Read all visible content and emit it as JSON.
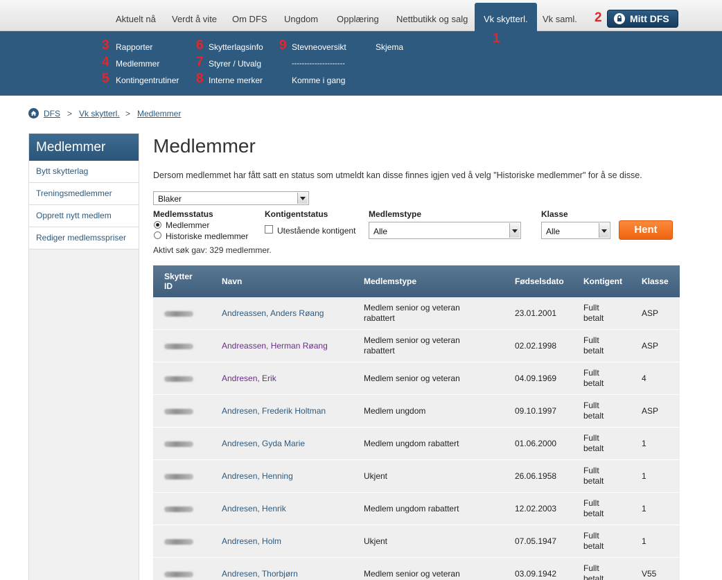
{
  "topnav": {
    "tabs": [
      {
        "label": "Aktuelt nå"
      },
      {
        "label": "Verdt å vite"
      },
      {
        "label": "Om DFS"
      },
      {
        "label": "Ungdom"
      },
      {
        "label": "Opplæring"
      },
      {
        "label": "Nettbutikk og salg"
      },
      {
        "label": "Vk skytterl."
      },
      {
        "label": "Vk saml."
      }
    ],
    "mitt_dfs": "Mitt DFS",
    "annotations": [
      "1",
      "2"
    ]
  },
  "submenu": {
    "items": [
      {
        "label": "Rapporter",
        "num": "3"
      },
      {
        "label": "Medlemmer",
        "num": "4"
      },
      {
        "label": "Kontingentrutiner",
        "num": "5"
      },
      {
        "label": "Skytterlagsinfo",
        "num": "6"
      },
      {
        "label": "Styrer / Utvalg",
        "num": "7"
      },
      {
        "label": "Interne merker",
        "num": "8"
      },
      {
        "label": "Stevneoversikt",
        "num": "9"
      },
      {
        "label": "Komme i gang"
      },
      {
        "label": "Skjema"
      }
    ],
    "separator": "---------------------"
  },
  "breadcrumb": {
    "items": [
      "DFS",
      "Vk skytterl.",
      "Medlemmer"
    ],
    "sep": ">"
  },
  "sidebar": {
    "title": "Medlemmer",
    "links": [
      "Bytt skytterlag",
      "Treningsmedlemmer",
      "Opprett nytt medlem",
      "Rediger medlemsspriser"
    ]
  },
  "main": {
    "title": "Medlemmer",
    "intro": "Dersom medlemmet har fått satt en status som utmeldt kan disse finnes igjen ved å velg \"Historiske medlemmer\" for å se disse.",
    "club_select": "Blaker",
    "filters": {
      "status_label": "Medlemsstatus",
      "status_options": [
        "Medlemmer",
        "Historiske medlemmer"
      ],
      "kontigent_label": "Kontigentstatus",
      "kontigent_option": "Utestående kontigent",
      "type_label": "Medlemstype",
      "type_value": "Alle",
      "klasse_label": "Klasse",
      "klasse_value": "Alle",
      "button": "Hent"
    },
    "result": "Aktivt søk gav: 329 medlemmer."
  },
  "table": {
    "headers": [
      "Skytter ID",
      "Navn",
      "Medlemstype",
      "Fødselsdato",
      "Kontigent",
      "Klasse"
    ],
    "rows": [
      {
        "name": "Andreassen, Anders Røang",
        "type": "Medlem senior og veteran rabattert",
        "dob": "23.01.2001",
        "fee": "Fullt betalt",
        "klasse": "ASP",
        "visited": false
      },
      {
        "name": "Andreassen, Herman Røang",
        "type": "Medlem senior og veteran rabattert",
        "dob": "02.02.1998",
        "fee": "Fullt betalt",
        "klasse": "ASP",
        "visited": true
      },
      {
        "name": "Andresen, Erik",
        "type": "Medlem senior og veteran",
        "dob": "04.09.1969",
        "fee": "Fullt betalt",
        "klasse": "4",
        "visited": true
      },
      {
        "name": "Andresen, Frederik Holtman",
        "type": "Medlem ungdom",
        "dob": "09.10.1997",
        "fee": "Fullt betalt",
        "klasse": "ASP",
        "visited": false
      },
      {
        "name": "Andresen, Gyda Marie",
        "type": "Medlem ungdom rabattert",
        "dob": "01.06.2000",
        "fee": "Fullt betalt",
        "klasse": "1",
        "visited": false
      },
      {
        "name": "Andresen, Henning",
        "type": "Ukjent",
        "dob": "26.06.1958",
        "fee": "Fullt betalt",
        "klasse": "1",
        "visited": false
      },
      {
        "name": "Andresen, Henrik",
        "type": "Medlem ungdom rabattert",
        "dob": "12.02.2003",
        "fee": "Fullt betalt",
        "klasse": "1",
        "visited": false
      },
      {
        "name": "Andresen, Holm",
        "type": "Ukjent",
        "dob": "07.05.1947",
        "fee": "Fullt betalt",
        "klasse": "1",
        "visited": false
      },
      {
        "name": "Andresen, Thorbjørn",
        "type": "Medlem senior og veteran",
        "dob": "03.09.1942",
        "fee": "Fullt betalt",
        "klasse": "V55",
        "visited": false
      }
    ]
  }
}
